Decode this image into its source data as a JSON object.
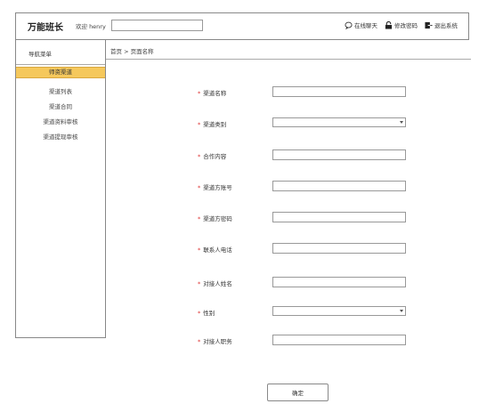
{
  "header": {
    "brand": "万能班长",
    "welcome": "欢迎 henry",
    "search_value": "",
    "actions": [
      {
        "label": "在线聊天",
        "icon": "chat-bubble-icon"
      },
      {
        "label": "修改密码",
        "icon": "lock-icon"
      },
      {
        "label": "退出系统",
        "icon": "logout-icon"
      }
    ]
  },
  "sidebar": {
    "title": "导航菜单",
    "active_item": "师资渠道",
    "items": [
      {
        "label": "渠道列表"
      },
      {
        "label": "渠道合同"
      },
      {
        "label": "渠道资料审核"
      },
      {
        "label": "渠道提现审核"
      }
    ]
  },
  "breadcrumb": "首页 > 页面名称",
  "form": {
    "required_mark": "*",
    "fields": [
      {
        "label": "渠道名称",
        "type": "text",
        "value": ""
      },
      {
        "label": "渠道类别",
        "type": "select",
        "value": ""
      },
      {
        "label": "合作内容",
        "type": "text",
        "value": ""
      },
      {
        "label": "渠道方账号",
        "type": "text",
        "value": ""
      },
      {
        "label": "渠道方密码",
        "type": "text",
        "value": ""
      },
      {
        "label": "联系人电话",
        "type": "text",
        "value": ""
      },
      {
        "label": "对接人姓名",
        "type": "text",
        "value": ""
      },
      {
        "label": "性别",
        "type": "select",
        "value": ""
      },
      {
        "label": "对接人职务",
        "type": "text",
        "value": ""
      }
    ],
    "submit_label": "确定"
  },
  "colors": {
    "active_nav": "#f5c85c",
    "required": "#d33333",
    "border": "#888888"
  }
}
